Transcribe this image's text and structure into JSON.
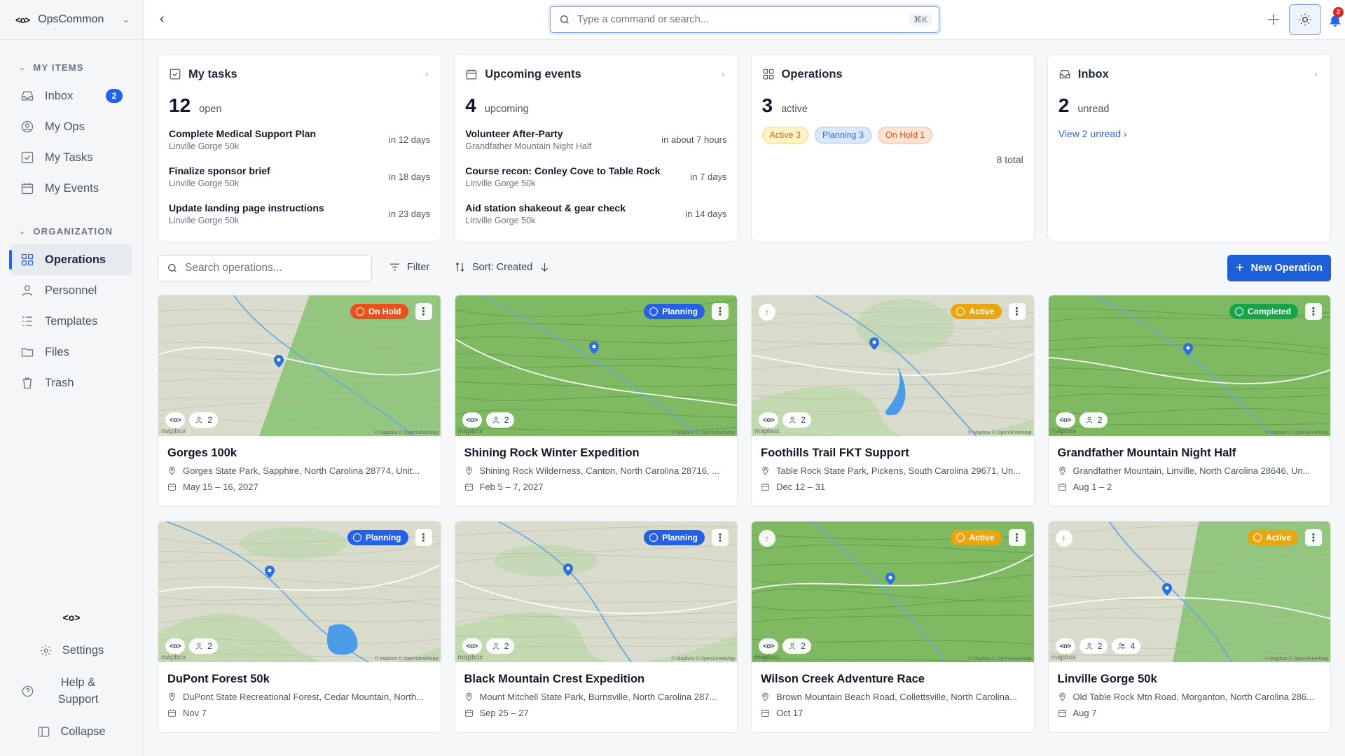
{
  "app": {
    "name": "OpsCommon",
    "logo": "<o>"
  },
  "sidebar": {
    "my_items_label": "MY ITEMS",
    "my_items": [
      {
        "label": "Inbox",
        "icon": "inbox-icon",
        "badge": "2"
      },
      {
        "label": "My Ops",
        "icon": "user-circle-icon"
      },
      {
        "label": "My Tasks",
        "icon": "checkbox-icon"
      },
      {
        "label": "My Events",
        "icon": "calendar-icon"
      }
    ],
    "org_label": "ORGANIZATION",
    "org_items": [
      {
        "label": "Operations",
        "icon": "grid-icon",
        "active": true
      },
      {
        "label": "Personnel",
        "icon": "person-icon"
      },
      {
        "label": "Templates",
        "icon": "list-icon"
      },
      {
        "label": "Files",
        "icon": "folder-icon"
      },
      {
        "label": "Trash",
        "icon": "trash-icon"
      }
    ],
    "settings": "Settings",
    "help": "Help & Support",
    "collapse": "Collapse"
  },
  "topbar": {
    "search_placeholder": "Type a command or search...",
    "shortcut": "⌘K",
    "notification_count": "2"
  },
  "summary": {
    "tasks": {
      "title": "My tasks",
      "count": "12",
      "count_label": "open",
      "items": [
        {
          "title": "Complete Medical Support Plan",
          "sub": "Linville Gorge 50k",
          "when": "in 12 days"
        },
        {
          "title": "Finalize sponsor brief",
          "sub": "Linville Gorge 50k",
          "when": "in 18 days"
        },
        {
          "title": "Update landing page instructions",
          "sub": "Linville Gorge 50k",
          "when": "in 23 days"
        }
      ]
    },
    "events": {
      "title": "Upcoming events",
      "count": "4",
      "count_label": "upcoming",
      "items": [
        {
          "title": "Volunteer After-Party",
          "sub": "Grandfather Mountain Night Half",
          "when": "in about 7 hours"
        },
        {
          "title": "Course recon: Conley Cove to Table Rock",
          "sub": "Linville Gorge 50k",
          "when": "in 7 days"
        },
        {
          "title": "Aid station shakeout & gear check",
          "sub": "Linville Gorge 50k",
          "when": "in 14 days"
        }
      ]
    },
    "operations": {
      "title": "Operations",
      "count": "3",
      "count_label": "active",
      "total": "8 total",
      "pills": {
        "active": "Active 3",
        "planning": "Planning 3",
        "hold": "On Hold 1"
      }
    },
    "inbox": {
      "title": "Inbox",
      "count": "2",
      "count_label": "unread",
      "link": "View 2 unread"
    }
  },
  "toolbar": {
    "search_placeholder": "Search operations...",
    "filter": "Filter",
    "sort": "Sort: Created",
    "new_button": "New Operation"
  },
  "operations": [
    {
      "title": "Gorges 100k",
      "location": "Gorges State Park, Sapphire, North Carolina 28774, Unit...",
      "dates": "May 15 – 16, 2027",
      "status": "On Hold",
      "status_key": "hold",
      "people": "2",
      "theme": "mixed"
    },
    {
      "title": "Shining Rock Winter Expedition",
      "location": "Shining Rock Wilderness, Canton, North Carolina 28716, ...",
      "dates": "Feb 5 – 7, 2027",
      "status": "Planning",
      "status_key": "planning",
      "people": "2",
      "theme": "forest"
    },
    {
      "title": "Foothills Trail FKT Support",
      "location": "Table Rock State Park, Pickens, South Carolina 29671, Un...",
      "dates": "Dec 12 – 31",
      "status": "Active",
      "status_key": "active",
      "people": "2",
      "theme": "grey"
    },
    {
      "title": "Grandfather Mountain Night Half",
      "location": "Grandfather Mountain, Linville, North Carolina 28646, Un...",
      "dates": "Aug 1 – 2",
      "status": "Completed",
      "status_key": "completed",
      "people": "2",
      "theme": "forest"
    },
    {
      "title": "DuPont Forest 50k",
      "location": "DuPont State Recreational Forest, Cedar Mountain, North...",
      "dates": "Nov 7",
      "status": "Planning",
      "status_key": "planning",
      "people": "2",
      "theme": "grey"
    },
    {
      "title": "Black Mountain Crest Expedition",
      "location": "Mount Mitchell State Park, Burnsville, North Carolina 287...",
      "dates": "Sep 25 – 27",
      "status": "Planning",
      "status_key": "planning",
      "people": "2",
      "theme": "grey"
    },
    {
      "title": "Wilson Creek Adventure Race",
      "location": "Brown Mountain Beach Road, Collettsville, North Carolina...",
      "dates": "Oct 17",
      "status": "Active",
      "status_key": "active",
      "people": "2",
      "theme": "forest"
    },
    {
      "title": "Linville Gorge 50k",
      "location": "Old Table Rock Mtn Road, Morganton, North Carolina 286...",
      "dates": "Aug 7",
      "status": "Active",
      "status_key": "active",
      "people": "2",
      "extra": "4",
      "theme": "mixed"
    }
  ],
  "map": {
    "brand": "mapbox",
    "credit": "© Mapbox © OpenStreetMap"
  },
  "colors": {
    "accent": "#2563eb",
    "forest": "#6fb05c",
    "terrain": "#d9dccd"
  }
}
